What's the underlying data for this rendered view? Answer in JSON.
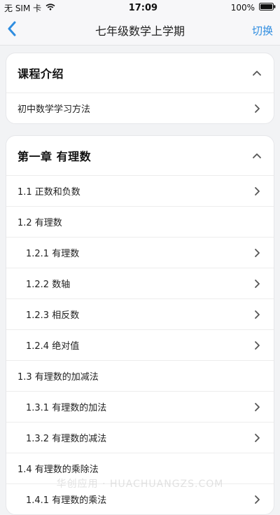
{
  "status_bar": {
    "carrier": "无 SIM 卡",
    "time": "17:09",
    "battery": "100%"
  },
  "nav": {
    "title": "七年级数学上学期",
    "action_label": "切换"
  },
  "course_intro": {
    "title": "课程介绍",
    "items": [
      {
        "label": "初中数学学习方法"
      }
    ]
  },
  "chapter1": {
    "title": "第一章 有理数",
    "items": [
      {
        "label": "1.1 正数和负数"
      },
      {
        "label": "1.2 有理数"
      },
      {
        "label": "1.2.1 有理数"
      },
      {
        "label": "1.2.2 数轴"
      },
      {
        "label": "1.2.3 相反数"
      },
      {
        "label": "1.2.4 绝对值"
      },
      {
        "label": "1.3 有理数的加减法"
      },
      {
        "label": "1.3.1 有理数的加法"
      },
      {
        "label": "1.3.2 有理数的减法"
      },
      {
        "label": "1.4 有理数的乘除法"
      },
      {
        "label": "1.4.1 有理数的乘法"
      }
    ]
  },
  "watermark": "华创应用 · HUACHUANGZS.COM",
  "colors": {
    "accent": "#2f8de0",
    "background": "#f2f3f5",
    "card": "#ffffff"
  }
}
